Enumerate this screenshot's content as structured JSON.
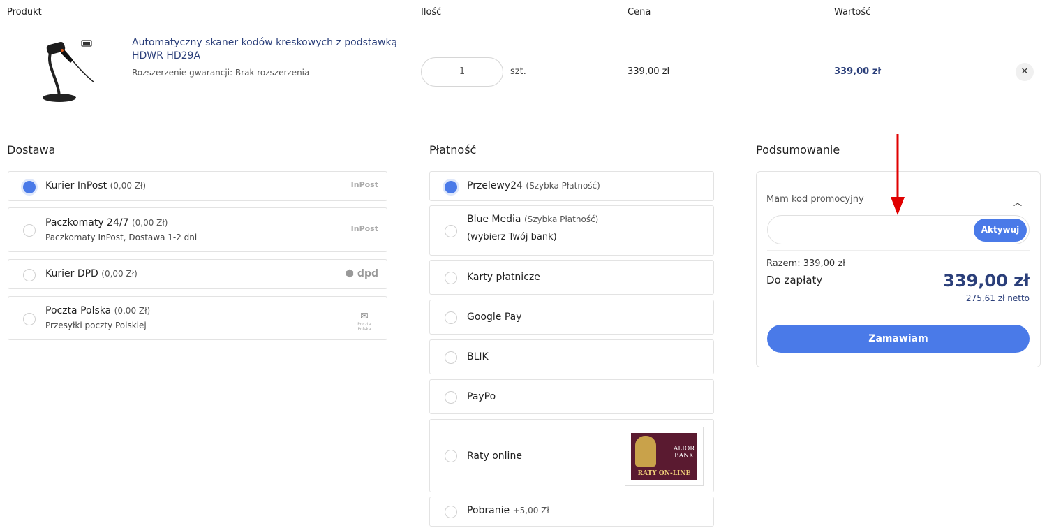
{
  "columns": {
    "product": "Produkt",
    "qty": "Ilość",
    "price": "Cena",
    "value": "Wartość"
  },
  "item": {
    "title": "Automatyczny skaner kodów kreskowych z podstawką HDWR HD29A",
    "subtitle": "Rozszerzenie gwarancji: Brak rozszerzenia",
    "qty": "1",
    "unit": "szt.",
    "price": "339,00 zł",
    "value": "339,00 zł",
    "remove_icon": "close-icon"
  },
  "delivery": {
    "heading": "Dostawa",
    "options": [
      {
        "name": "Kurier InPost",
        "price": "(0,00 Zł)",
        "sub": "",
        "logo": "InPost",
        "selected": true
      },
      {
        "name": "Paczkomaty 24/7",
        "price": "(0,00 Zł)",
        "sub": "Paczkomaty InPost, Dostawa 1-2 dni",
        "logo": "InPost",
        "selected": false
      },
      {
        "name": "Kurier DPD",
        "price": "(0,00 Zł)",
        "sub": "",
        "logo": "dpd",
        "selected": false
      },
      {
        "name": "Poczta Polska",
        "price": "(0,00 Zł)",
        "sub": "Przesyłki poczty Polskiej",
        "logo": "Poczta Polska",
        "selected": false
      }
    ]
  },
  "payment": {
    "heading": "Płatność",
    "options": [
      {
        "name": "Przelewy24",
        "note": "(Szybka Płatność)",
        "sub": "",
        "selected": true
      },
      {
        "name": "Blue Media",
        "note": "(Szybka Płatność)",
        "sub": "(wybierz Twój bank)",
        "selected": false
      },
      {
        "name": "Karty płatnicze",
        "note": "",
        "sub": "",
        "selected": false
      },
      {
        "name": "Google Pay",
        "note": "",
        "sub": "",
        "selected": false
      },
      {
        "name": "BLIK",
        "note": "",
        "sub": "",
        "selected": false
      },
      {
        "name": "PayPo",
        "note": "",
        "sub": "",
        "selected": false
      },
      {
        "name": "Raty online",
        "note": "",
        "sub": "",
        "selected": false
      },
      {
        "name": "Pobranie",
        "note": "+5,00 Zł",
        "sub": "",
        "selected": false
      }
    ],
    "alior_logo": {
      "line1": "ALIOR",
      "line2": "BANK",
      "line3": "RATY ON-LINE"
    }
  },
  "summary": {
    "heading": "Podsumowanie",
    "promo_label": "Mam kod promocyjny",
    "promo_placeholder": "",
    "promo_button": "Aktywuj",
    "razem": "Razem: 339,00 zł",
    "do_zaplaty": "Do zapłaty",
    "total": "339,00 zł",
    "netto": "275,61 zł netto",
    "order_button": "Zamawiam"
  },
  "colors": {
    "accent": "#4a7ae8",
    "navy": "#2b3f7a",
    "annotation_arrow": "#e00000"
  }
}
